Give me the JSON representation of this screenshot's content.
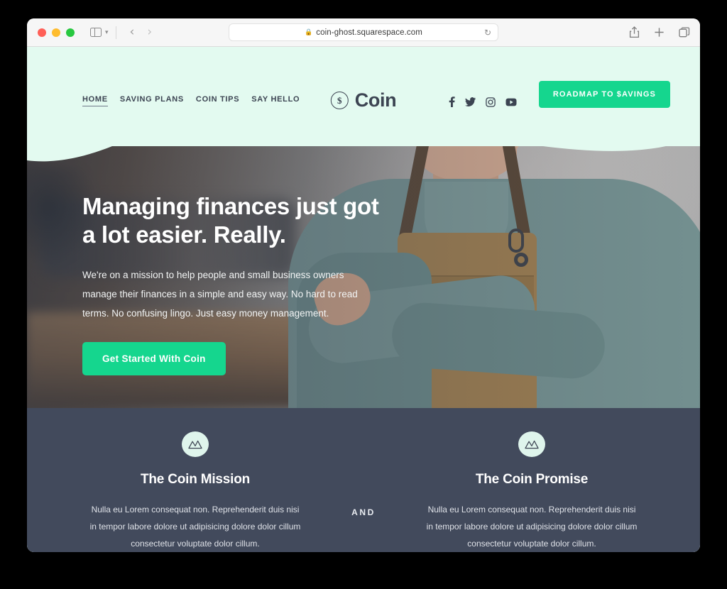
{
  "browser": {
    "url": "coin-ghost.squarespace.com",
    "lock_icon": "lock-icon",
    "reload_icon": "reload-icon",
    "back_icon": "back-arrow-icon",
    "forward_icon": "forward-arrow-icon",
    "sidebar_icon": "sidebar-toggle-icon",
    "tab_chevron": "chevron-down-icon",
    "share_icon": "share-icon",
    "new_tab_icon": "plus-icon",
    "tab_overview_icon": "tab-overview-icon"
  },
  "site": {
    "nav": [
      {
        "label": "HOME",
        "active": true
      },
      {
        "label": "SAVING PLANS",
        "active": false
      },
      {
        "label": "COIN TIPS",
        "active": false
      },
      {
        "label": "SAY HELLO",
        "active": false
      }
    ],
    "logo": {
      "mark": "dollar-sign-circle-icon",
      "symbol": "$",
      "word": "Coin"
    },
    "social": [
      {
        "name": "facebook-icon"
      },
      {
        "name": "twitter-icon"
      },
      {
        "name": "instagram-icon"
      },
      {
        "name": "youtube-icon"
      }
    ],
    "header_cta": "ROADMAP TO $AVINGS"
  },
  "hero": {
    "headline": "Managing finances just got a lot easier. Really.",
    "subtext": "We're on a mission to help people and small business owners manage their finances in a simple and easy way. No hard to read terms. No confusing lingo. Just easy money management.",
    "cta": "Get Started With Coin",
    "image_alt": "smiling-young-man-in-apron-arms-crossed-workshop"
  },
  "features": {
    "divider": "AND",
    "columns": [
      {
        "icon": "mountain-peaks-icon",
        "title": "The Coin Mission",
        "body": "Nulla eu Lorem consequat non. Reprehenderit duis nisi in tempor labore dolore ut adipisicing dolore dolor cillum consectetur voluptate dolor cillum."
      },
      {
        "icon": "mountain-peaks-icon",
        "title": "The Coin Promise",
        "body": "Nulla eu Lorem consequat non. Reprehenderit duis nisi in tempor labore dolore ut adipisicing dolore dolor cillum consectetur voluptate dolor cillum."
      }
    ]
  },
  "colors": {
    "accent_green": "#15d68e",
    "header_mint": "#e3faf0",
    "dark_slate": "#424a5c",
    "text_dark": "#3c4452"
  }
}
